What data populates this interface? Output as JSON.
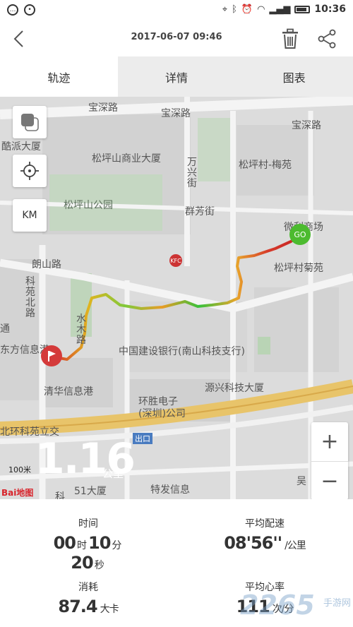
{
  "status_bar": {
    "time": "10:36"
  },
  "header": {
    "title": "2017-06-07 09:46"
  },
  "tabs": [
    {
      "label": "轨迹",
      "active": true
    },
    {
      "label": "详情",
      "active": false
    },
    {
      "label": "图表",
      "active": false
    }
  ],
  "map": {
    "labels": {
      "baoshen_road_1": "宝深路",
      "baoshen_road_2": "宝深路",
      "baoshen_road_3": "宝深路",
      "kupai": "酷派大厦",
      "songpingshan_commercial": "松坪山商业大厦",
      "wanxing_street": "万兴街",
      "songpingcun_meiyuan": "松坪村-梅苑",
      "songpingshan_park": "松坪山公园",
      "qunfang_street": "群芳街",
      "weili_market": "微利商场",
      "langshan_road": "朗山路",
      "kefang_north_road": "科苑北路",
      "songpingcun_juyuan": "松坪村菊苑",
      "shuimu_road": "水木路",
      "dongfang_info": "东方信息港",
      "ccb": "中国建设银行(南山科技支行)",
      "yuanxing_tech": "源兴科技大厦",
      "tsinghua_info": "清华信息港",
      "huansheng": "环胜电子(深圳)公司",
      "ring_interchange": "北环科苑立交",
      "exit": "出口",
      "dasha_51": "51大厦",
      "teyou_info": "特发信息",
      "wuqi": "吴",
      "tong": "通",
      "ke": "科"
    },
    "controls": {
      "km_label": "KM"
    },
    "markers": {
      "start_label": "GO"
    },
    "distance_value": "1.16",
    "distance_unit": "公里",
    "scale_label": "100米",
    "logo_text": "Bai地图"
  },
  "stats": {
    "time": {
      "label": "时间",
      "hours": "00",
      "h_unit": "时",
      "minutes": "10",
      "m_unit": "分",
      "seconds": "20",
      "s_unit": "秒"
    },
    "pace": {
      "label": "平均配速",
      "value": "08'56''",
      "unit": "/公里"
    },
    "calories": {
      "label": "消耗",
      "value": "87.4",
      "unit": "大卡"
    },
    "heart_rate": {
      "label": "平均心率",
      "value": "111",
      "unit": "次/分"
    }
  },
  "watermark": {
    "text": "2265",
    "sub": "手游网"
  },
  "colors": {
    "go_marker": "#4cbb2f",
    "flag_marker": "#d43a3a",
    "tab_inactive_bg": "#ececec"
  }
}
